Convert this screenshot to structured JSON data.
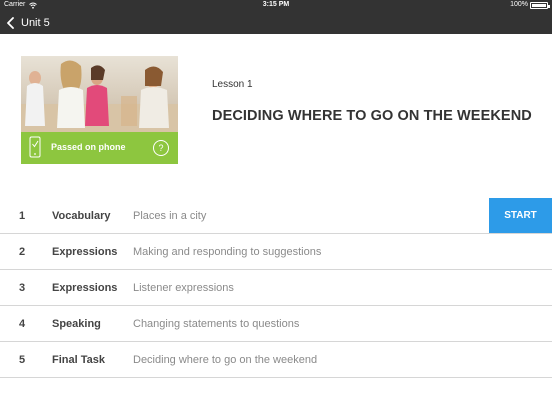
{
  "status_bar": {
    "carrier": "Carrier",
    "time": "3:15 PM",
    "battery": "100%"
  },
  "nav": {
    "back_label": "Unit 5"
  },
  "lesson": {
    "number_label": "Lesson 1",
    "title": "DECIDING WHERE TO GO ON THE WEEKEND",
    "passed_label": "Passed on phone",
    "help_glyph": "?"
  },
  "activities": [
    {
      "num": "1",
      "type": "Vocabulary",
      "desc": "Places in a city"
    },
    {
      "num": "2",
      "type": "Expressions",
      "desc": "Making and responding to suggestions"
    },
    {
      "num": "3",
      "type": "Expressions",
      "desc": "Listener expressions"
    },
    {
      "num": "4",
      "type": "Speaking",
      "desc": "Changing statements to questions"
    },
    {
      "num": "5",
      "type": "Final Task",
      "desc": "Deciding where to go on the weekend"
    }
  ],
  "start_label": "START",
  "colors": {
    "nav_bg": "#333333",
    "passed_green": "#8dc63f",
    "start_blue": "#2d9be8"
  }
}
